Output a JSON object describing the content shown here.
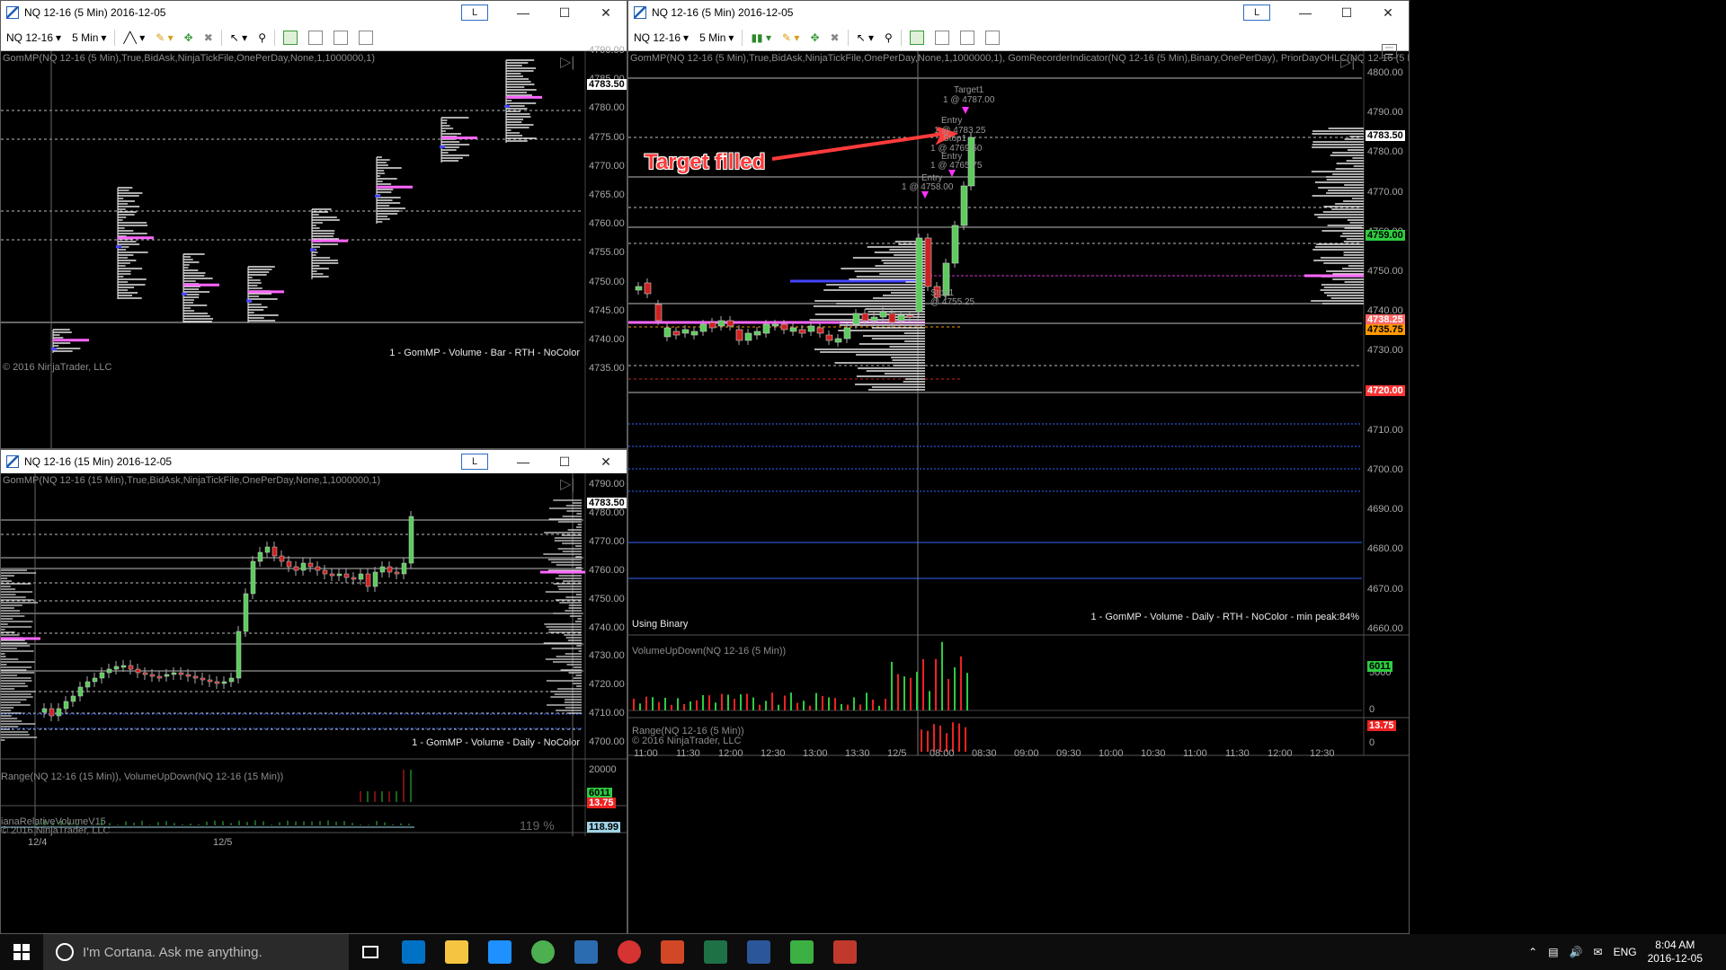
{
  "windows": {
    "tl": {
      "title": "NQ 12-16 (5 Min)  2016-12-05",
      "instrument": "NQ 12-16",
      "interval": "5 Min",
      "indicator": "GomMP(NQ 12-16 (5 Min),True,BidAsk,NinjaTickFile,OnePerDay,None,1,1000000,1)",
      "footer": "1 - GomMP  - Volume - Bar - RTH - NoColor",
      "copyright": "© 2016 NinjaTrader, LLC",
      "axis": [
        "4790.00",
        "4785.00",
        "4780.00",
        "4775.00",
        "4770.00",
        "4765.00",
        "4760.00",
        "4755.00",
        "4750.00",
        "4745.00",
        "4740.00",
        "4735.00"
      ],
      "last_price": "4783.50"
    },
    "bl": {
      "title": "NQ 12-16 (15 Min)  2016-12-05",
      "indicator": "GomMP(NQ 12-16 (15 Min),True,BidAsk,NinjaTickFile,OnePerDay,None,1,1000000,1)",
      "footer": "1 - GomMP  - Volume - Daily - NoColor",
      "axis": [
        "4790.00",
        "4780.00",
        "4770.00",
        "4760.00",
        "4750.00",
        "4740.00",
        "4730.00",
        "4720.00",
        "4710.00",
        "4700.00"
      ],
      "last_price": "4783.50",
      "panel2_label": "Range(NQ 12-16 (15 Min)), VolumeUpDown(NQ 12-16 (15 Min))",
      "panel2_axis": "20000",
      "panel2_tags": [
        "6011",
        "13.75"
      ],
      "panel3_label": "ianaRelativeVolumeV15",
      "panel3_copyright": "© 2016 NinjaTrader, LLC",
      "panel3_value": "119 %",
      "panel3_tag": "118.99",
      "x_labels": [
        "12/4",
        "12/5"
      ]
    },
    "right": {
      "title": "NQ 12-16 (5 Min)  2016-12-05",
      "instrument": "NQ 12-16",
      "interval": "5 Min",
      "indicator": "GomMP(NQ 12-16 (5 Min),True,BidAsk,NinjaTickFile,OnePerDay,None,1,1000000,1), GomRecorderIndicator(NQ 12-16 (5 Min),Binary,OnePerDay), PriorDayOHLC(NQ 12-16 (5 Min))",
      "using": "Using Binary",
      "footer": "1 - GomMP  - Volume - Daily - RTH - NoColor - min peak:84%",
      "annotation": "Target filled",
      "axis": [
        "4800.00",
        "4790.00",
        "4780.00",
        "4770.00",
        "4760.00",
        "4750.00",
        "4740.00",
        "4730.00",
        "4720.00",
        "4710.00",
        "4700.00",
        "4690.00",
        "4680.00",
        "4670.00",
        "4660.00"
      ],
      "price_tags": [
        {
          "value": "4783.50",
          "color": "#ffffff"
        },
        {
          "value": "4759.00",
          "color": "#2ecc40"
        },
        {
          "value": "4738.25",
          "color": "#ff6666"
        },
        {
          "value": "4735.75",
          "color": "#ff9900"
        },
        {
          "value": "4720.00",
          "color": "#ff3333"
        }
      ],
      "orders": [
        {
          "label": "Target1"
        },
        {
          "label": "1 @ 4787.00"
        },
        {
          "label": "Entry"
        },
        {
          "label": "1 @ 4783.25"
        },
        {
          "label": "Stop1"
        },
        {
          "label": "1 @ 4769.50"
        },
        {
          "label": "Entry"
        },
        {
          "label": "1 @ 4765.75"
        },
        {
          "label": "Entry"
        },
        {
          "label": "1 @ 4758.00"
        },
        {
          "label": "Stop1"
        },
        {
          "label": "@ 4755.25"
        }
      ],
      "panel2_label": "VolumeUpDown(NQ 12-16 (5 Min))",
      "panel2_axis": "5000",
      "panel2_zero": "0",
      "panel2_tag": "6011",
      "panel3_label": "Range(NQ 12-16 (5 Min))",
      "panel3_copyright": "© 2016 NinjaTrader, LLC",
      "panel3_axis": "0",
      "panel3_tag": "13.75",
      "x_labels": [
        "11:00",
        "11:30",
        "12:00",
        "12:30",
        "13:00",
        "13:30",
        "12/5",
        "08:00",
        "08:30",
        "09:00",
        "09:30",
        "10:00",
        "10:30",
        "11:00",
        "11:30",
        "12:00",
        "12:30"
      ]
    }
  },
  "taskbar": {
    "search_placeholder": "I'm Cortana. Ask me anything.",
    "apps": [
      "outlook",
      "file-explorer",
      "edge",
      "chrome",
      "tws",
      "ninjatrader",
      "powerpoint",
      "excel",
      "word",
      "app-green",
      "app-red"
    ],
    "app_colors": [
      "#0072c6",
      "#f5c542",
      "#1e90ff",
      "#4caf50",
      "#2b6cb0",
      "#d63333",
      "#d24726",
      "#1e7145",
      "#2b579a",
      "#3cb043",
      "#c0392b"
    ],
    "language": "ENG",
    "time": "8:04 AM",
    "date": "2016-12-05"
  }
}
